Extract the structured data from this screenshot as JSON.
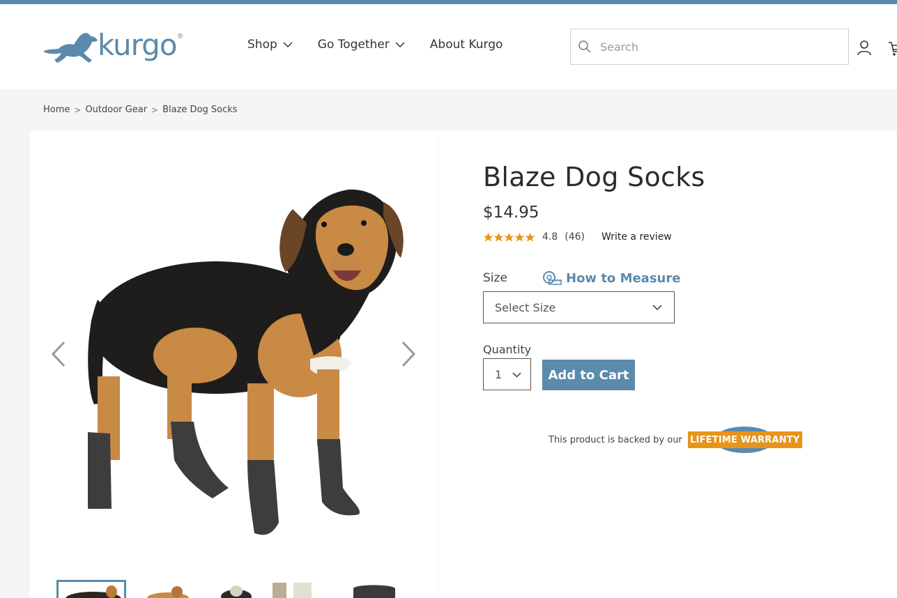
{
  "brand": {
    "logo_text": "kurgo",
    "logo_reg": "®",
    "accent_color": "#5a8aac",
    "warranty_color": "#e8941a"
  },
  "nav": {
    "items": [
      {
        "label": "Shop",
        "has_dropdown": true
      },
      {
        "label": "Go Together",
        "has_dropdown": true
      },
      {
        "label": "About Kurgo",
        "has_dropdown": false
      }
    ]
  },
  "search": {
    "placeholder": "Search",
    "value": ""
  },
  "header_icons": [
    "search-icon",
    "account-icon",
    "cart-icon"
  ],
  "breadcrumb": {
    "items": [
      "Home",
      "Outdoor Gear",
      "Blaze Dog Socks"
    ],
    "separator": ">"
  },
  "gallery": {
    "main_image": "dog-wearing-socks",
    "thumbnail_count": 5,
    "active_thumbnail": 1
  },
  "product": {
    "title": "Blaze Dog Socks",
    "price": "$14.95",
    "rating": {
      "stars": 5,
      "value": "4.8",
      "count": "(46)",
      "write_review": "Write a review"
    },
    "size": {
      "label": "Size",
      "how_to_measure": "How to Measure",
      "select_placeholder": "Select Size"
    },
    "quantity": {
      "label": "Quantity",
      "value": "1"
    },
    "add_to_cart": "Add to Cart",
    "warranty": {
      "text": "This product is backed by our",
      "badge": "LIFETIME WARRANTY"
    }
  }
}
